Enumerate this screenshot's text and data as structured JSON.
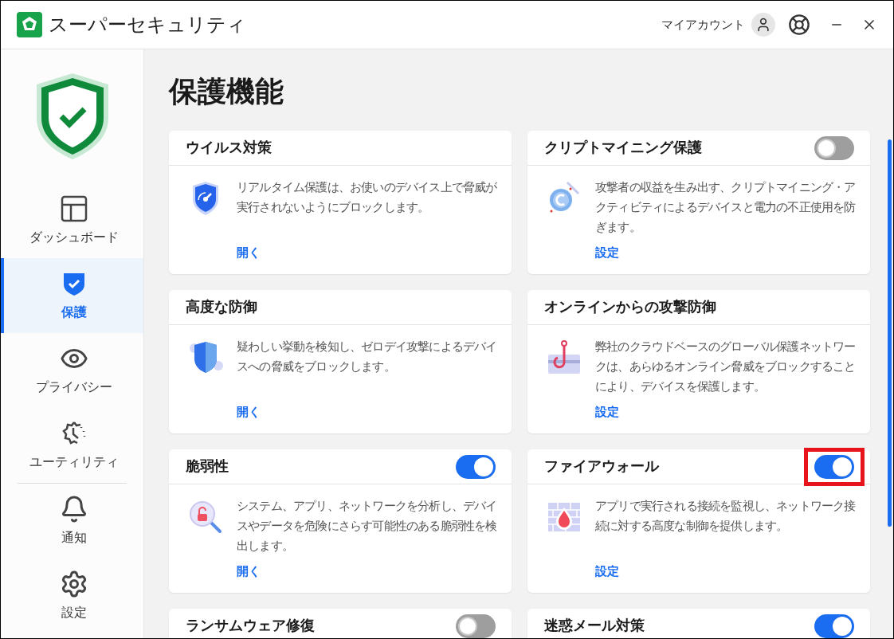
{
  "window": {
    "title": "スーパーセキュリティ",
    "account_label": "マイアカウント"
  },
  "sidebar": {
    "items": [
      {
        "label": "ダッシュボード",
        "selected": false
      },
      {
        "label": "保護",
        "selected": true
      },
      {
        "label": "プライバシー",
        "selected": false
      },
      {
        "label": "ユーティリティ",
        "selected": false
      },
      {
        "label": "通知",
        "selected": false
      },
      {
        "label": "設定",
        "selected": false
      }
    ]
  },
  "page": {
    "heading": "保護機能"
  },
  "cards": [
    {
      "title": "ウイルス対策",
      "description": "リアルタイム保護は、お使いのデバイス上で脅威が実行されないようにブロックします。",
      "link": "開く"
    },
    {
      "title": "クリプトマイニング保護",
      "toggle": {
        "on": false
      },
      "description": "攻撃者の収益を生み出す、クリプトマイニング・アクティビティによるデバイスと電力の不正使用を防ぎます。",
      "link": "設定"
    },
    {
      "title": "高度な防御",
      "description": "疑わしい挙動を検知し、ゼロデイ攻撃によるデバイスへの脅威をブロックします。",
      "link": "開く"
    },
    {
      "title": "オンラインからの攻撃防御",
      "description": "弊社のクラウドベースのグローバル保護ネットワークは、あらゆるオンライン脅威をブロックすることにより、デバイスを保護します。",
      "link": "設定"
    },
    {
      "title": "脆弱性",
      "toggle": {
        "on": true
      },
      "description": "システム、アプリ、ネットワークを分析し、デバイスやデータを危険にさらす可能性のある脆弱性を検出します。",
      "link": "開く"
    },
    {
      "title": "ファイアウォール",
      "toggle": {
        "on": true
      },
      "highlighted": true,
      "description": "アプリで実行される接続を監視し、ネットワーク接続に対する高度な制御を提供します。",
      "link": "設定"
    },
    {
      "title": "ランサムウェア修復",
      "toggle": {
        "on": false
      }
    },
    {
      "title": "迷惑メール対策",
      "toggle": {
        "on": true
      }
    }
  ]
}
